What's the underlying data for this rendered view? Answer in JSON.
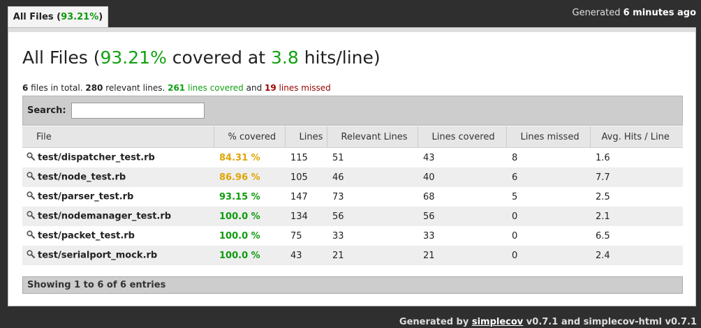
{
  "tab": {
    "label": "All Files",
    "percent": "93.21%"
  },
  "generated": {
    "prefix": "Generated",
    "when": "6 minutes ago"
  },
  "heading": {
    "prefix": "All Files (",
    "percent": "93.21%",
    "middle": " covered at ",
    "hits": "3.8",
    "suffix": " hits/line)"
  },
  "summary": {
    "files": "6",
    "files_text": " files in total. ",
    "relevant": "280",
    "relevant_text": " relevant lines. ",
    "covered": "261",
    "covered_text": " lines covered",
    "and_text": " and ",
    "missed": "19",
    "missed_text": " lines missed"
  },
  "search": {
    "label": "Search:",
    "value": ""
  },
  "columns": [
    "File",
    "% covered",
    "Lines",
    "Relevant Lines",
    "Lines covered",
    "Lines missed",
    "Avg. Hits / Line"
  ],
  "rows": [
    {
      "file": "test/dispatcher_test.rb",
      "covered": "84.31 %",
      "lines": "115",
      "relevant": "51",
      "lines_covered": "43",
      "missed": "8",
      "avg": "1.6"
    },
    {
      "file": "test/node_test.rb",
      "covered": "86.96 %",
      "lines": "105",
      "relevant": "46",
      "lines_covered": "40",
      "missed": "6",
      "avg": "7.7"
    },
    {
      "file": "test/parser_test.rb",
      "covered": "93.15 %",
      "lines": "147",
      "relevant": "73",
      "lines_covered": "68",
      "missed": "5",
      "avg": "2.5"
    },
    {
      "file": "test/nodemanager_test.rb",
      "covered": "100.0 %",
      "lines": "134",
      "relevant": "56",
      "lines_covered": "56",
      "missed": "0",
      "avg": "2.1"
    },
    {
      "file": "test/packet_test.rb",
      "covered": "100.0 %",
      "lines": "75",
      "relevant": "33",
      "lines_covered": "33",
      "missed": "0",
      "avg": "6.5"
    },
    {
      "file": "test/serialport_mock.rb",
      "covered": "100.0 %",
      "lines": "43",
      "relevant": "21",
      "lines_covered": "21",
      "missed": "0",
      "avg": "2.4"
    }
  ],
  "entries_info": "Showing 1 to 6 of 6 entries",
  "credit": {
    "prefix": "Generated by ",
    "link": "simplecov",
    "suffix": " v0.7.1 and simplecov-html v0.7.1"
  },
  "colors": {
    "good": "#0f9b0f",
    "warning": "#dfa504",
    "missed": "#990000"
  }
}
